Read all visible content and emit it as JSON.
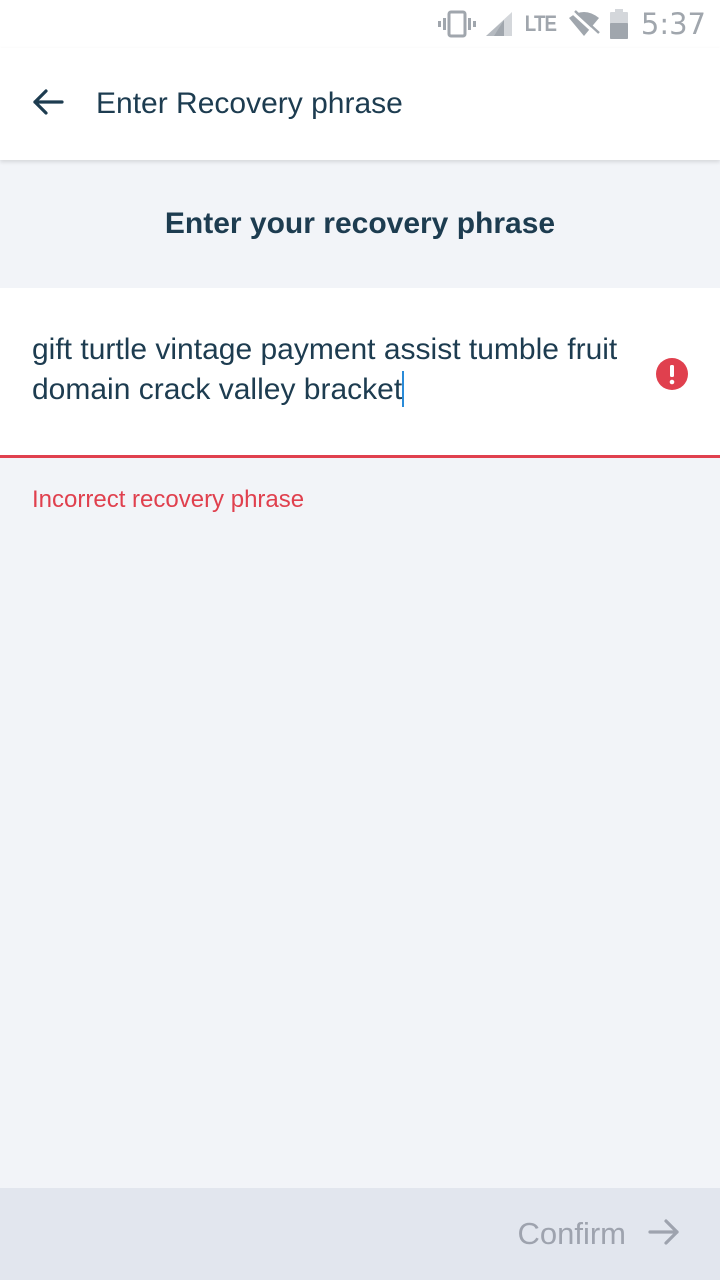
{
  "status_bar": {
    "network": "LTE",
    "time": "5:37",
    "icons": [
      "vibrate-icon",
      "signal-icon",
      "wifi-off-icon",
      "battery-icon"
    ]
  },
  "app_bar": {
    "title": "Enter Recovery phrase",
    "back_icon": "arrow-left-icon"
  },
  "main": {
    "heading": "Enter your recovery phrase",
    "phrase_input": {
      "value": "gift turtle vintage payment assist tumble fruit domain crack valley bracket",
      "state": "error"
    },
    "error_message": "Incorrect recovery phrase"
  },
  "footer": {
    "confirm_label": "Confirm",
    "confirm_icon": "arrow-right-icon",
    "confirm_enabled": false
  },
  "colors": {
    "accent_text": "#1d3c50",
    "error": "#e0404e",
    "disabled": "#9ea3ae",
    "background": "#f2f4f8",
    "caret": "#2a8bd8"
  }
}
